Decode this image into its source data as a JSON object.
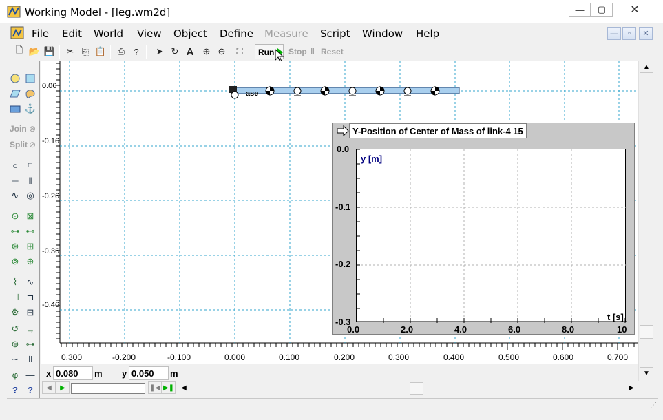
{
  "window": {
    "title": "Working Model - [leg.wm2d]"
  },
  "menu": [
    {
      "label": "File",
      "disabled": false
    },
    {
      "label": "Edit",
      "disabled": false
    },
    {
      "label": "World",
      "disabled": false
    },
    {
      "label": "View",
      "disabled": false
    },
    {
      "label": "Object",
      "disabled": false
    },
    {
      "label": "Define",
      "disabled": false
    },
    {
      "label": "Measure",
      "disabled": true
    },
    {
      "label": "Script",
      "disabled": false
    },
    {
      "label": "Window",
      "disabled": false
    },
    {
      "label": "Help",
      "disabled": false
    }
  ],
  "toolbar": {
    "run_label": "Run",
    "stop_label": "Stop",
    "reset_label": "Reset"
  },
  "palette": {
    "join_label": "Join",
    "split_label": "Split"
  },
  "workspace": {
    "x_ticks": [
      "0.300",
      "-0.200",
      "-0.100",
      "0.000",
      "0.100",
      "0.200",
      "0.300",
      "0.400",
      "0.500",
      "0.600",
      "0.700"
    ],
    "y_ticks": [
      "0.06",
      "-0.16",
      "-0.26",
      "-0.36",
      "-0.46"
    ],
    "body_label": "ase"
  },
  "meter": {
    "title": "Y-Position of Center of Mass of link-4 15",
    "y_axis_label": "y [m]",
    "x_axis_label": "t [s]",
    "y_ticks": [
      "0.0",
      "-0.1",
      "-0.2",
      "-0.3"
    ],
    "x_ticks": [
      "0.0",
      "2.0",
      "4.0",
      "6.0",
      "8.0",
      "10"
    ]
  },
  "coords": {
    "x_label": "x",
    "x_value": "0.080",
    "x_unit": "m",
    "y_label": "y",
    "y_value": "0.050",
    "y_unit": "m"
  },
  "colors": {
    "grid": "#33a6cc",
    "link_fill": "#a9cfee",
    "meter_bg": "#c8c8c8",
    "axis_label": "#00007f",
    "run_arrow": "#00b000"
  }
}
